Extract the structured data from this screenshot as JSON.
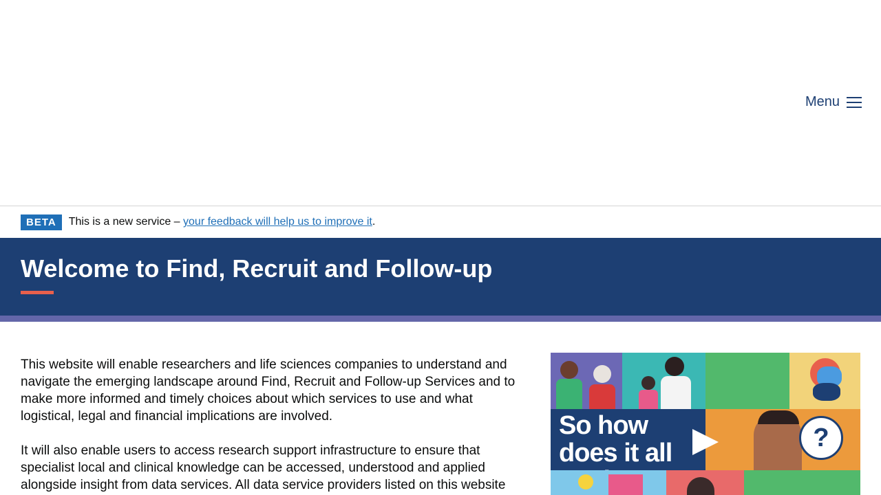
{
  "header": {
    "menu_label": "Menu"
  },
  "beta_banner": {
    "tag": "BETA",
    "text_before": "This is a new service – ",
    "link_text": "your feedback will help us to improve it",
    "text_after": "."
  },
  "hero": {
    "title": "Welcome to Find, Recruit and Follow-up"
  },
  "main": {
    "paragraphs": [
      "This website will enable researchers and life sciences companies to understand and navigate the emerging landscape around Find, Recruit and Follow-up Services and to make more informed and timely choices about which services to use and what logistical, legal and financial implications are involved.",
      "It will also enable users to access research support infrastructure to ensure that specialist local and clinical knowledge can be accessed, understood and applied alongside insight from data services. All data service providers listed on this website"
    ]
  },
  "video": {
    "title": "So how does it all work?",
    "question_mark": "?"
  },
  "colors": {
    "brand_navy": "#1d3f73",
    "link_blue": "#1f6fb7",
    "accent_coral": "#e8604c",
    "stripe_purple": "#6366a9"
  }
}
